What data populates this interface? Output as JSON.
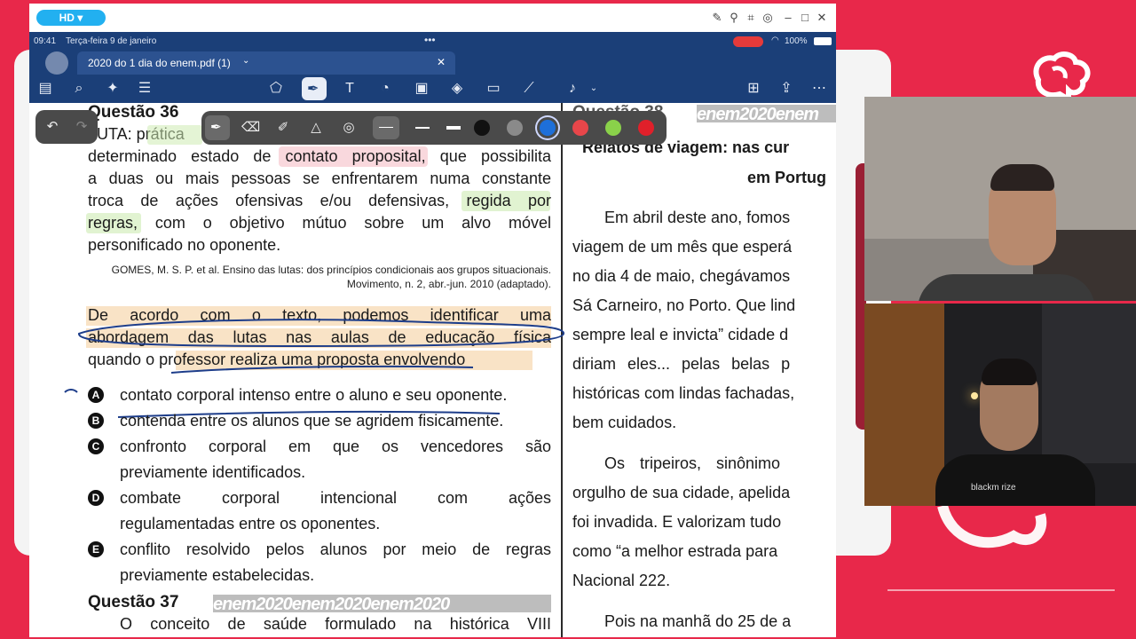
{
  "topbar": {
    "quality_badge": "HD ▾"
  },
  "status_bar": {
    "time": "09:41",
    "date": "Terça-feira 9 de janeiro",
    "battery": "100%"
  },
  "tab": {
    "title": "2020 do 1 dia do enem.pdf (1)"
  },
  "question36": {
    "heading": "Questão 36",
    "lines": [
      "LUTA: prática",
      "determinado estado de contato proposital, que possibilita",
      "a duas ou mais pessoas se enfrentarem numa constante",
      "troca de ações ofensivas e/ou defensivas, regida por",
      "regras, com o objetivo mútuo sobre um alvo móvel",
      "personificado no oponente."
    ],
    "citation_line1": "GOMES, M. S. P. et al. Ensino das lutas: dos princípios condicionais aos grupos situacionais.",
    "citation_line2": "Movimento, n. 2, abr.-jun. 2010 (adaptado).",
    "prompt_lines": [
      "De acordo com o texto, podemos identificar uma",
      "abordagem das lutas nas aulas de educação física",
      "quando o professor realiza uma proposta envolvendo"
    ],
    "options": [
      {
        "letter": "A",
        "lines": [
          "contato corporal intenso entre o aluno e seu oponente."
        ]
      },
      {
        "letter": "B",
        "lines": [
          "contenda entre os alunos que se agridem fisicamente."
        ]
      },
      {
        "letter": "C",
        "lines": [
          "confronto corporal em que os vencedores são",
          "previamente identificados."
        ]
      },
      {
        "letter": "D",
        "lines": [
          "combate corporal intencional com ações",
          "regulamentadas entre os oponentes."
        ]
      },
      {
        "letter": "E",
        "lines": [
          "conflito resolvido pelos alunos por meio de regras",
          "previamente estabelecidas."
        ]
      }
    ]
  },
  "question37": {
    "heading": "Questão 37",
    "watermark": "enem2020enem2020enem2020",
    "first_line": "O conceito de saúde formulado na histórica VIII"
  },
  "question38": {
    "heading": "Questão 38",
    "watermark": "enem2020enem",
    "title_lines": [
      "Relatos de viagem: nas cur",
      "em Portug"
    ],
    "paragraph1": [
      "Em abril deste ano, fomos",
      "viagem de um mês que esperá",
      "no dia 4 de maio, chegávamos",
      "Sá Carneiro, no Porto. Que lind",
      "sempre leal e invicta” cidade d",
      "diriam eles... pelas belas p",
      "históricas com lindas fachadas,",
      "bem cuidados."
    ],
    "paragraph2": [
      "Os tripeiros, sinônimo",
      "orgulho de sua cidade, apelida",
      "foi invadida. E valorizam tudo",
      "como “a melhor estrada para",
      "Nacional 222."
    ],
    "paragraph3_first": "Pois na manhã do 25 de a"
  },
  "pen_colors": [
    "#111111",
    "#8a8a8a",
    "#1e6fd9",
    "#e8464a",
    "#8ad14a",
    "#e0202a"
  ],
  "camera_overlay": {
    "shirt_text": "blackm  rize"
  }
}
